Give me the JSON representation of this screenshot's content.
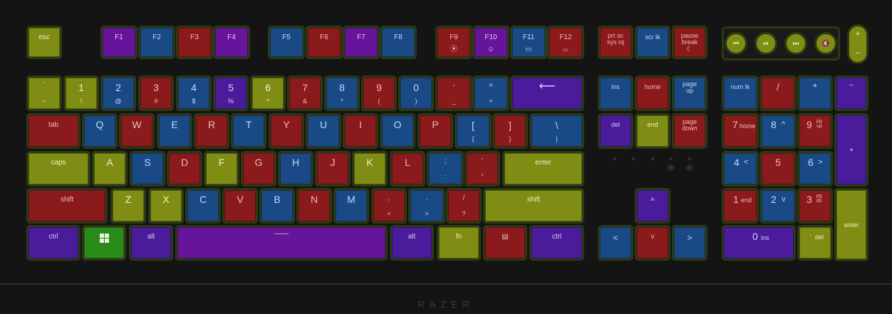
{
  "brand": "RAZER",
  "keys": {
    "esc": "esc",
    "f1": "F1",
    "f2": "F2",
    "f3": "F3",
    "f4": "F4",
    "f5": "F5",
    "f6": "F6",
    "f7": "F7",
    "f8": "F8",
    "f9": "F9",
    "f10": "F10",
    "f11": "F11",
    "f12": "F12",
    "prtsc_1": "prt sc",
    "prtsc_2": "sys rq",
    "scrlk": "scr lk",
    "pause_1": "pause",
    "pause_2": "break",
    "backtick_top": "`",
    "backtick_bot": "~",
    "n1_top": "1",
    "n1_bot": "!",
    "n2_top": "2",
    "n2_bot": "@",
    "n3_top": "3",
    "n3_bot": "#",
    "n4_top": "4",
    "n4_bot": "$",
    "n5_top": "5",
    "n5_bot": "%",
    "n6_top": "6",
    "n6_bot": "^",
    "n7_top": "7",
    "n7_bot": "&",
    "n8_top": "8",
    "n8_bot": "*",
    "n9_top": "9",
    "n9_bot": "(",
    "n0_top": "0",
    "n0_bot": ")",
    "minus_top": "-",
    "minus_bot": "_",
    "equal_top": "=",
    "equal_bot": "+",
    "backspace": "⟵",
    "ins": "ins",
    "home": "home",
    "pgup_1": "page",
    "pgup_2": "up",
    "numlk": "num lk",
    "np_slash": "/",
    "np_star": "*",
    "np_minus": "−",
    "tab": "tab",
    "q": "Q",
    "w": "W",
    "e": "E",
    "r": "R",
    "t": "T",
    "y": "Y",
    "u": "U",
    "i": "I",
    "o": "O",
    "p": "P",
    "lbracket_top": "[",
    "lbracket_bot": "{",
    "rbracket_top": "]",
    "rbracket_bot": "}",
    "backslash_top": "\\",
    "backslash_bot": "|",
    "del": "del",
    "end": "end",
    "pgdn_1": "page",
    "pgdn_2": "down",
    "np7": "7",
    "np7_sub": "home",
    "np8": "8",
    "np8_sub": "^",
    "np9": "9",
    "np9_sub1": "pg",
    "np9_sub2": "up",
    "np_plus": "+",
    "caps": "caps",
    "a": "A",
    "s": "S",
    "d": "D",
    "f": "F",
    "g": "G",
    "h": "H",
    "j": "J",
    "k": "K",
    "l": "L",
    "semi_top": ";",
    "semi_bot": ":",
    "quote_top": "'",
    "quote_bot": "\"",
    "enter": "enter",
    "np4": "4",
    "np4_sub": "<",
    "np5": "5",
    "np6": "6",
    "np6_sub": ">",
    "lshift": "shift",
    "z": "Z",
    "x": "X",
    "c": "C",
    "v": "V",
    "b": "B",
    "n": "N",
    "m": "M",
    "comma_top": ",",
    "comma_bot": "<",
    "period_top": ".",
    "period_bot": ">",
    "slash_top": "/",
    "slash_bot": "?",
    "rshift": "shift",
    "up": "^",
    "np1": "1",
    "np1_sub": "end",
    "np2": "2",
    "np2_sub": "v",
    "np3": "3",
    "np3_sub1": "pg",
    "np3_sub2": "dn",
    "np_enter": "enter",
    "lctrl": "ctrl",
    "lalt": "alt",
    "space": "——",
    "ralt": "alt",
    "fn": "fn",
    "menu": "▤",
    "rctrl": "ctrl",
    "left": "<",
    "down": "v",
    "right": ">",
    "np0": "0",
    "np0_sub": "ins",
    "np_dot": ".",
    "np_dot_sub": "del",
    "vol_up": "+",
    "vol_down": "−"
  },
  "media": {
    "prev": "⏮",
    "play": "⏯",
    "next": "⏭",
    "mute": "🔇"
  },
  "icons": {
    "f9": "⦿",
    "f10": "☺",
    "f11": "▭",
    "f12": "⌓",
    "pause": "☾"
  },
  "colors": {
    "red": "#8a1a1c",
    "blue": "#1a4a86",
    "purple": "#66159a",
    "yellow": "#7f8d14",
    "indigo": "#4a1c9b",
    "green": "#2a8a1a",
    "border": "#2c3a14",
    "background": "#141414"
  }
}
